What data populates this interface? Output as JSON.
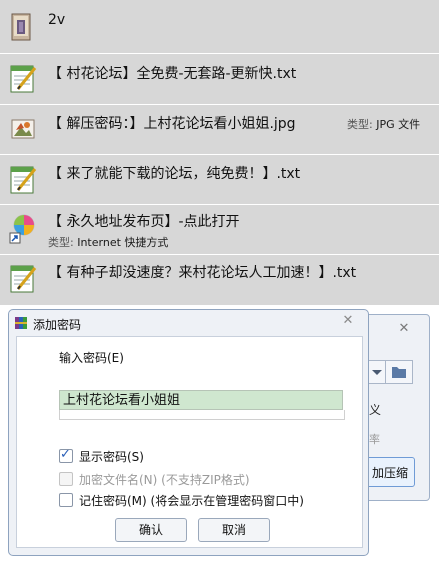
{
  "files": [
    {
      "name": "2v",
      "icon": "rar-archive-icon"
    },
    {
      "name": "【 村花论坛】全免费-无套路-更新快.txt",
      "icon": "notepad-icon"
    },
    {
      "name": "【 解压密码：】上村花论坛看小姐姐.jpg",
      "icon": "image-file-icon",
      "meta_label": "类型:",
      "meta_value": "JPG 文件"
    },
    {
      "name": "【 来了就能下载的论坛，纯免费！】.txt",
      "icon": "notepad-icon"
    },
    {
      "name": "【 永久地址发布页】-点此打开",
      "icon": "internet-shortcut-icon",
      "meta_label": "类型:",
      "meta_value": "Internet 快捷方式"
    },
    {
      "name": "【 有种子却没速度？来村花论坛人工加速！】.txt",
      "icon": "notepad-icon"
    }
  ],
  "background_dialog": {
    "text1": "义",
    "text2": "率",
    "button_label": "加压缩"
  },
  "dialog": {
    "title": "添加密码",
    "input_label": "输入密码(E)",
    "password_value": "上村花论坛看小姐姐",
    "show_password": {
      "label": "显示密码(S)",
      "checked": true
    },
    "encrypt_names": {
      "label": "加密文件名(N)",
      "note": "(不支持ZIP格式)",
      "enabled": false
    },
    "remember": {
      "label": "记住密码(M)",
      "note": "(将会显示在管理密码窗口中)",
      "checked": false
    },
    "ok_label": "确认",
    "cancel_label": "取消"
  }
}
